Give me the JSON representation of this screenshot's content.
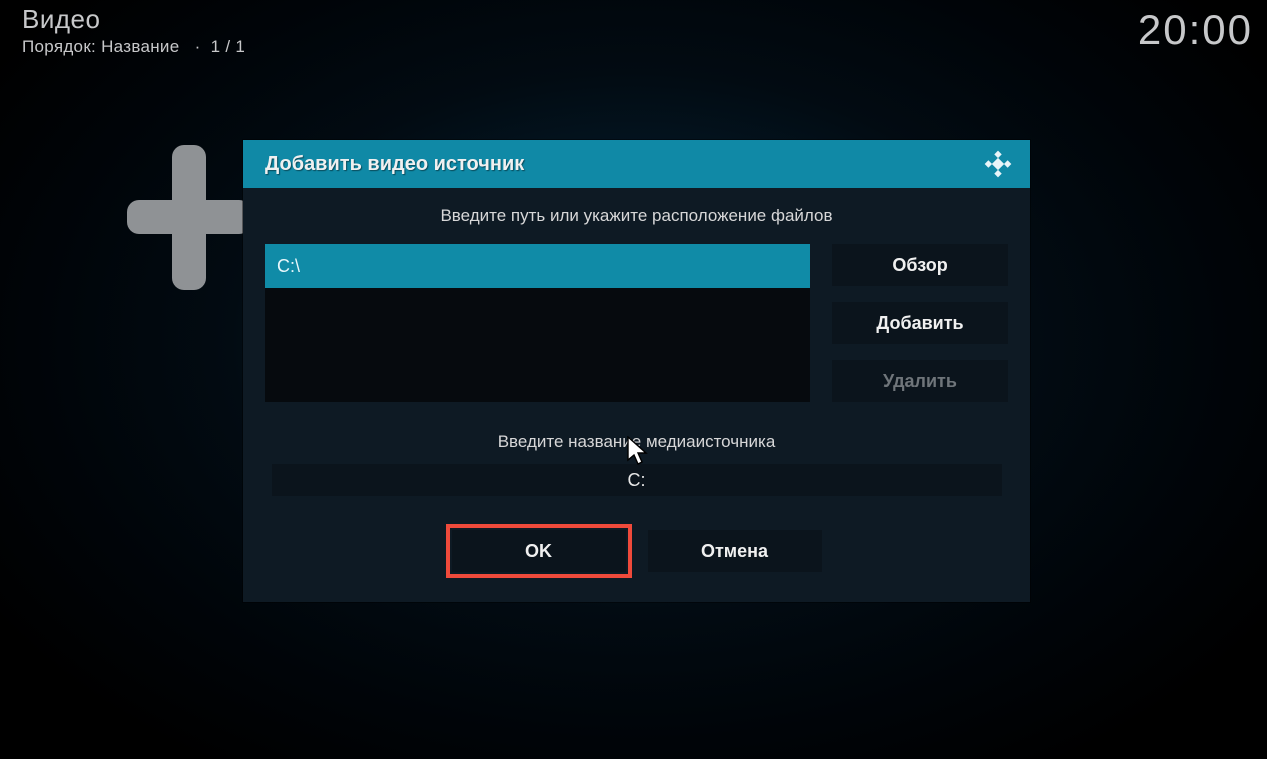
{
  "header": {
    "title": "Видео",
    "order_prefix": "Порядок: ",
    "order_value": "Название",
    "separator": "·",
    "page_indicator": "1 / 1"
  },
  "clock": "20:00",
  "dialog": {
    "title": "Добавить видео источник",
    "prompt_path": "Введите путь или укажите расположение файлов",
    "paths": [
      "C:\\"
    ],
    "buttons": {
      "browse": "Обзор",
      "add": "Добавить",
      "remove": "Удалить"
    },
    "prompt_name": "Введите название медиаисточника",
    "source_name": "C:",
    "ok": "OK",
    "cancel": "Отмена"
  }
}
